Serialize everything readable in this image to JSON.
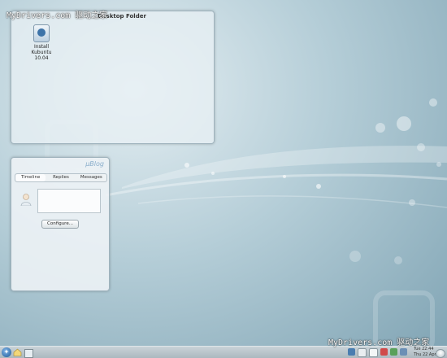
{
  "watermark": {
    "top": "MyDrivers.com 驱动之家",
    "bottom": "MyDrivers.com 驱动之家"
  },
  "folder_view": {
    "title": "Desktop Folder"
  },
  "desktop_icons": [
    {
      "label": "Install\nKubuntu 10.04",
      "icon": "installer-icon"
    }
  ],
  "microblog": {
    "logo": "µBlog",
    "tabs": [
      "Timeline",
      "Replies",
      "Messages"
    ],
    "active_tab": "Timeline",
    "configure_label": "Configure..."
  },
  "panel": {
    "launcher_icon": "kde-kickoff-icon",
    "clock_time": "Tue 22:44",
    "clock_date": "Thu 22 Apr",
    "tray_icons": [
      "network-icon",
      "volume-icon",
      "clipboard-icon",
      "updates-icon",
      "battery-icon",
      "device-notifier-icon"
    ]
  },
  "colors": {
    "accent": "#3c73a8",
    "panel": "#b6c2c8",
    "wallpaper": "#8fb0be"
  }
}
